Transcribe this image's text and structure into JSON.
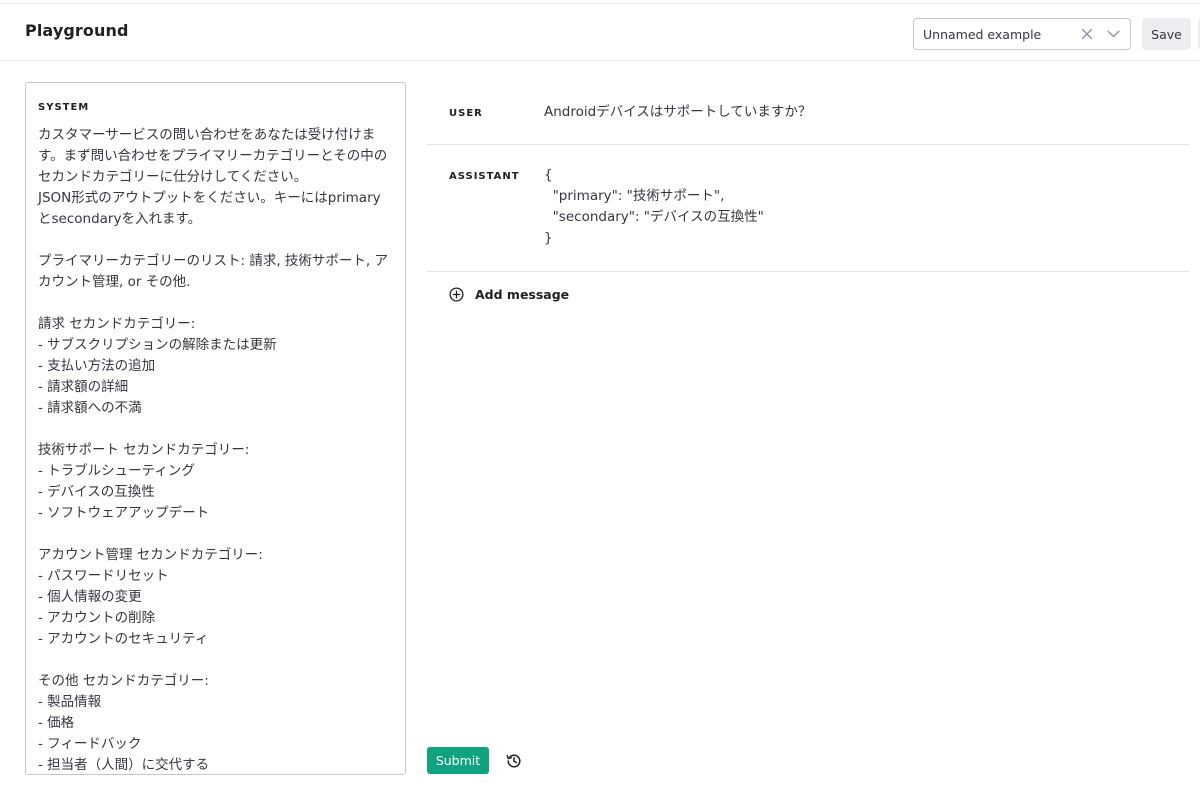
{
  "header": {
    "title": "Playground",
    "preset": {
      "value": "Unnamed example",
      "clear_icon": "close-icon",
      "chevron_icon": "chevron-down-icon"
    },
    "save_label": "Save"
  },
  "system": {
    "label": "SYSTEM",
    "text": "カスタマーサービスの問い合わせをあなたは受け付けます。まず問い合わせをプライマリーカテゴリーとその中のセカンドカテゴリーに仕分けしてください。\nJSON形式のアウトプットをください。キーにはprimaryとsecondaryを入れます。\n\nプライマリーカテゴリーのリスト: 請求, 技術サポート, アカウント管理, or その他.\n\n請求 セカンドカテゴリー:\n- サブスクリプションの解除または更新\n- 支払い方法の追加\n- 請求額の詳細\n- 請求額への不満\n\n技術サポート セカンドカテゴリー:\n- トラブルシューティング\n- デバイスの互換性\n- ソフトウェアアップデート\n\nアカウント管理 セカンドカテゴリー:\n- パスワードリセット\n- 個人情報の変更\n- アカウントの削除\n- アカウントのセキュリティ\n\nその他 セカンドカテゴリー:\n- 製品情報\n- 価格\n- フィードバック\n- 担当者（人間）に交代する"
  },
  "messages": [
    {
      "role": "USER",
      "content": "Androidデバイスはサポートしていますか？"
    },
    {
      "role": "ASSISTANT",
      "content": "{\n  \"primary\": \"技術サポート\",\n  \"secondary\": \"デバイスの互換性\"\n}"
    }
  ],
  "add_message": {
    "label": "Add message",
    "icon": "plus-circle-icon"
  },
  "footer": {
    "submit_label": "Submit",
    "history_icon": "history-icon"
  },
  "colors": {
    "accent": "#10a37f",
    "border": "#c5c5d2",
    "divider": "#e5e5e5",
    "text": "#353740",
    "button_bg": "#ececf1"
  }
}
